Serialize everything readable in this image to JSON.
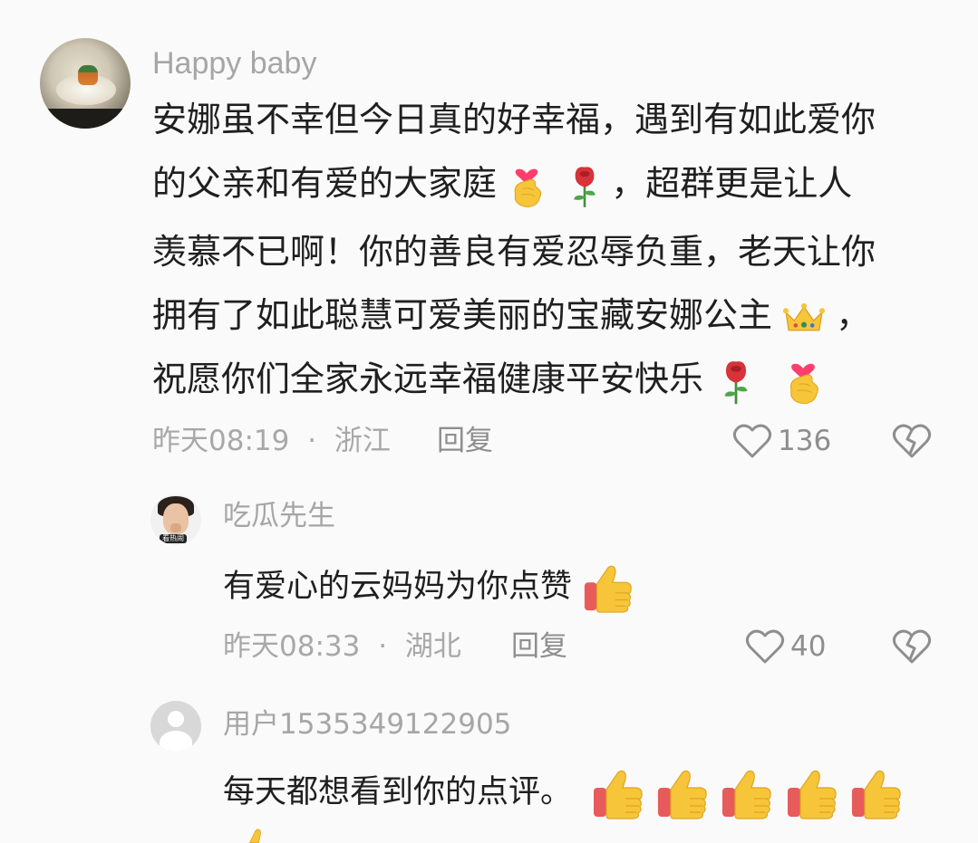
{
  "comments": [
    {
      "username": "Happy baby",
      "lines": [
        "安娜虽不幸但今日真的好幸福，遇到有如此爱你",
        "的父亲和有爱的大家庭",
        "，超群更是让人",
        "羡慕不已啊！你的善良有爱忍辱负重，老天让你",
        "拥有了如此聪慧可爱美丽的宝藏安娜公主",
        "，",
        "祝愿你们全家永远幸福健康平安快乐"
      ],
      "time": "昨天08:19",
      "separator": "·",
      "location": "浙江",
      "reply_label": "回复",
      "likes": "136",
      "icons": [
        "heart-finger-emoji",
        "rose-emoji",
        "crown-emoji",
        "like-heart-icon",
        "dislike-broken-heart-icon"
      ]
    },
    {
      "username": "吃瓜先生",
      "avatar_tag": "看热闹",
      "text": "有爱心的云妈妈为你点赞",
      "time": "昨天08:33",
      "separator": "·",
      "location": "湖北",
      "reply_label": "回复",
      "likes": "40",
      "icons": [
        "thumbs-up-emoji"
      ]
    },
    {
      "username": "用户1535349122905",
      "text": "每天都想看到你的点评。",
      "icons": [
        "thumbs-up-emoji"
      ]
    }
  ],
  "colors": {
    "background": "#fafafa",
    "text": "#1f1f1f",
    "muted": "#a8a8a8",
    "thumb": "#f6c53a",
    "thumb_cuff": "#e85b5b",
    "rose": "#d8323a"
  }
}
